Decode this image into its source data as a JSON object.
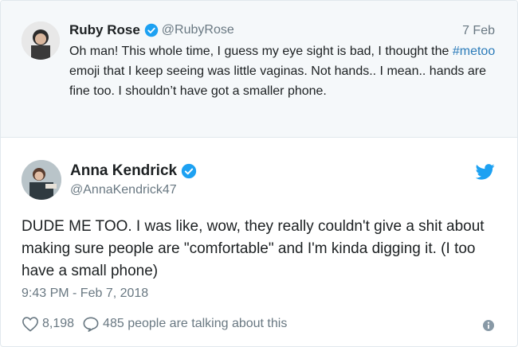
{
  "parent_tweet": {
    "author_name": "Ruby Rose",
    "handle": "@RubyRose",
    "date": "7 Feb",
    "text_before": "Oh man! This whole time, I guess my eye sight is bad, I thought the ",
    "hashtag": "#metoo",
    "text_after": " emoji that I keep seeing was little vaginas. Not hands.. I mean.. hands are fine too. I shouldn’t have got a smaller phone."
  },
  "main_tweet": {
    "author_name": "Anna Kendrick",
    "handle": "@AnnaKendrick47",
    "text": "DUDE ME TOO. I was like, wow, they really couldn't give a shit about making sure people are \"comfortable\" and I'm kinda digging it. (I too have a small phone)",
    "timestamp": "9:43 PM - Feb 7, 2018",
    "likes": "8,198",
    "replies_text": "485 people are talking about this"
  },
  "colors": {
    "verified": "#1da1f2",
    "link": "#2b7bb9",
    "muted": "#697882",
    "parent_bg": "#f5f8fa"
  },
  "icons": {
    "verified": "verified-badge-icon",
    "brand": "twitter-bird-icon",
    "like": "heart-icon",
    "reply": "speech-bubble-icon",
    "info": "info-icon"
  }
}
